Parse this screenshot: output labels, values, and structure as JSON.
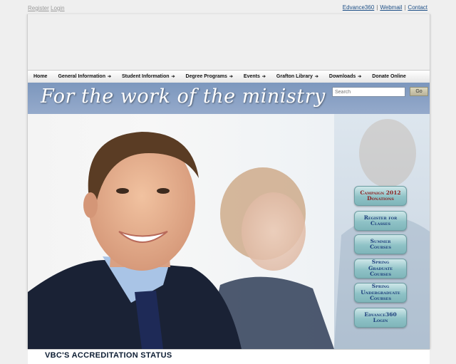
{
  "auth": {
    "register": "Register",
    "login": "Login"
  },
  "utility_links": [
    "Edvance360",
    "Webmail",
    "Contact"
  ],
  "nav": [
    "Home",
    "General Information",
    "Student Information",
    "Degree Programs",
    "Events",
    "Grafton Library",
    "Downloads",
    "Donate Online"
  ],
  "nav_has_arrow": [
    false,
    true,
    true,
    true,
    true,
    true,
    true,
    false
  ],
  "hero": {
    "tagline": "For the work of the ministry"
  },
  "search": {
    "placeholder": "Search",
    "button": "Go"
  },
  "side_buttons": [
    {
      "label": "Campaign 2012\nDonations"
    },
    {
      "label": "Register for\nClasses"
    },
    {
      "label": "Summer\nCourses"
    },
    {
      "label": "Spring\nGraduate\nCourses"
    },
    {
      "label": "Spring\nUndergraduate\nCourses"
    },
    {
      "label": "Edvance360\nLogin"
    }
  ],
  "content": {
    "heading": "VBC'S ACCREDITATION STATUS"
  },
  "colors": {
    "band": "#7c97bd",
    "nav_text": "#111111",
    "button_text": "#1d3f7c",
    "campaign_text": "#8b1e1e",
    "link": "#1d4f86"
  }
}
